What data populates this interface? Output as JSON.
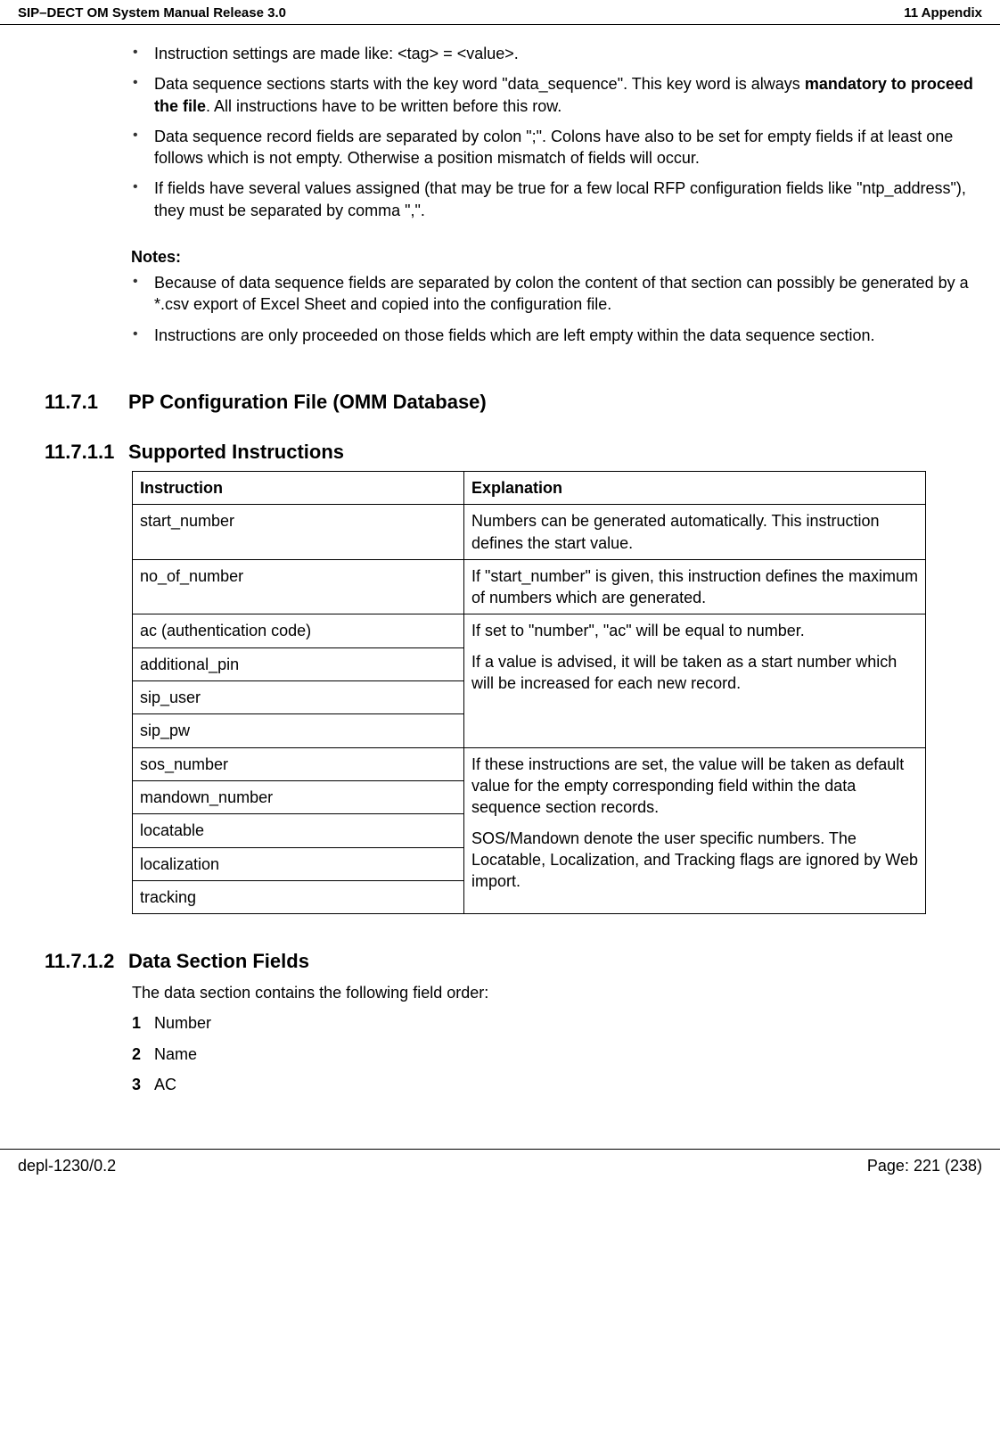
{
  "header": {
    "left": "SIP–DECT OM System Manual Release 3.0",
    "right": "11 Appendix"
  },
  "bullets1": {
    "b1_pre": "Instruction settings are made like: <tag> = <value>.",
    "b2_pre": "Data sequence sections starts with the key word \"data_sequence\". This key word is always ",
    "b2_bold": "mandatory to proceed the file",
    "b2_post": ". All instructions have to be written before this row.",
    "b3": "Data sequence record fields are separated by colon \";\". Colons have also to be set for empty fields if at least one follows which is not empty. Otherwise a position mismatch of fields will occur.",
    "b4": "If fields have several values assigned (that may be true for a few local RFP configuration fields like \"ntp_address\"), they must be separated by comma \",\"."
  },
  "notes": {
    "heading": "Notes:",
    "n1": "Because of data sequence fields are separated by colon the content of that section can possibly be generated by a *.csv export of Excel Sheet and copied into the configuration file.",
    "n2": "Instructions are only proceeded on those fields which are left empty within the data sequence section."
  },
  "sections": {
    "s1_num": "11.7.1",
    "s1_title": "PP Configuration File (OMM Database)",
    "s2_num": "11.7.1.1",
    "s2_title": "Supported Instructions",
    "s3_num": "11.7.1.2",
    "s3_title": "Data Section Fields"
  },
  "table": {
    "h1": "Instruction",
    "h2": "Explanation",
    "r1c1": "start_number",
    "r1c2": "Numbers can be generated automatically. This instruction defines the start value.",
    "r2c1": "no_of_number",
    "r2c2": "If \"start_number\" is given, this instruction defines the maximum of numbers which are generated.",
    "r3c1": "ac (authentication code)",
    "r3c2_p1": "If set to \"number\", \"ac\" will be equal to number.",
    "r3c2_p2": "If a value is advised, it will be taken as a start number which will be increased for each new record.",
    "r4c1": "additional_pin",
    "r5c1": "sip_user",
    "r6c1": "sip_pw",
    "r7c1": "sos_number",
    "r7c2_p1": "If these instructions are set, the value will be taken as default value for the empty corresponding field within the data sequence section records.",
    "r7c2_p2": "SOS/Mandown denote the user specific numbers. The Locatable, Localization, and Tracking flags are ignored by Web import.",
    "r8c1": "mandown_number",
    "r9c1": "locatable",
    "r10c1": "localization",
    "r11c1": "tracking"
  },
  "datasection": {
    "intro": "The data section contains the following field order:",
    "f1": "Number",
    "f2": "Name",
    "f3": "AC"
  },
  "footer": {
    "left": "depl-1230/0.2",
    "right": "Page: 221 (238)"
  }
}
